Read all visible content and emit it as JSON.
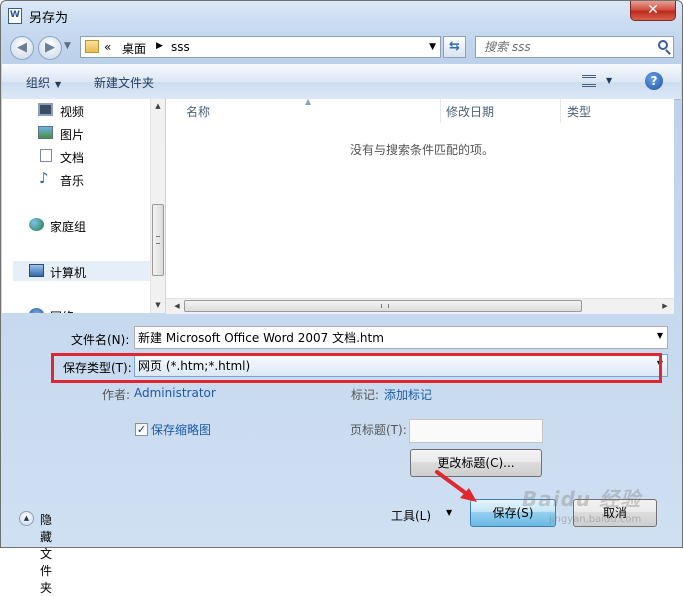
{
  "window": {
    "title": "另存为",
    "close_symbol": "✕"
  },
  "address": {
    "crumbs": [
      "«",
      "桌面",
      "sss"
    ],
    "search_placeholder": "搜索 sss"
  },
  "toolbar": {
    "organize": "组织",
    "new_folder": "新建文件夹",
    "help": "?"
  },
  "nav": {
    "items": [
      {
        "label": "视频",
        "icon": "video-icon"
      },
      {
        "label": "图片",
        "icon": "picture-icon"
      },
      {
        "label": "文档",
        "icon": "document-icon"
      },
      {
        "label": "音乐",
        "icon": "music-icon"
      },
      {
        "label": "家庭组",
        "icon": "homegroup-icon"
      },
      {
        "label": "计算机",
        "icon": "computer-icon"
      },
      {
        "label": "网络",
        "icon": "network-icon"
      }
    ]
  },
  "filelist": {
    "columns": [
      "名称",
      "修改日期",
      "类型"
    ],
    "empty_message": "没有与搜索条件匹配的项。"
  },
  "form": {
    "filename_label": "文件名(N):",
    "filename_value": "新建 Microsoft Office Word 2007 文档.htm",
    "savetype_label": "保存类型(T):",
    "savetype_value": "网页 (*.htm;*.html)",
    "author_label": "作者:",
    "author_value": "Administrator",
    "tags_label": "标记:",
    "tags_value": "添加标记",
    "thumbnail_checkbox": "保存缩略图",
    "thumbnail_checked": true,
    "page_title_label": "页标题(T):",
    "change_title_button": "更改标题(C)...",
    "tools_button": "工具(L)",
    "save_button": "保存(S)",
    "cancel_button": "取消",
    "hide_folders": "隐藏文件夹"
  },
  "annotation": {
    "highlight_color": "#e0262e",
    "watermark": "Baidu 经验",
    "watermark_sub": "jingyan.baidu.com"
  }
}
